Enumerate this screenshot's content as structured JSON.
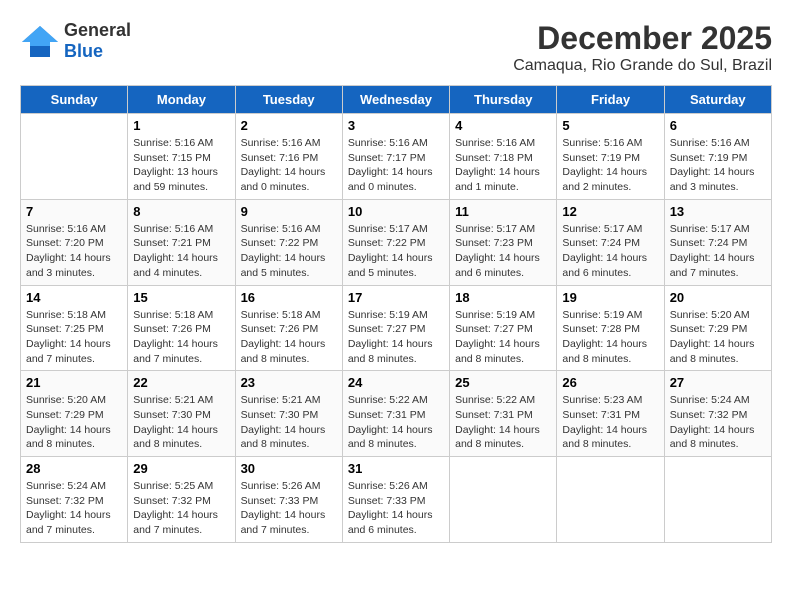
{
  "header": {
    "logo_line1": "General",
    "logo_line2": "Blue",
    "month": "December 2025",
    "location": "Camaqua, Rio Grande do Sul, Brazil"
  },
  "days_of_week": [
    "Sunday",
    "Monday",
    "Tuesday",
    "Wednesday",
    "Thursday",
    "Friday",
    "Saturday"
  ],
  "weeks": [
    [
      {
        "num": "",
        "info": ""
      },
      {
        "num": "1",
        "info": "Sunrise: 5:16 AM\nSunset: 7:15 PM\nDaylight: 13 hours\nand 59 minutes."
      },
      {
        "num": "2",
        "info": "Sunrise: 5:16 AM\nSunset: 7:16 PM\nDaylight: 14 hours\nand 0 minutes."
      },
      {
        "num": "3",
        "info": "Sunrise: 5:16 AM\nSunset: 7:17 PM\nDaylight: 14 hours\nand 0 minutes."
      },
      {
        "num": "4",
        "info": "Sunrise: 5:16 AM\nSunset: 7:18 PM\nDaylight: 14 hours\nand 1 minute."
      },
      {
        "num": "5",
        "info": "Sunrise: 5:16 AM\nSunset: 7:19 PM\nDaylight: 14 hours\nand 2 minutes."
      },
      {
        "num": "6",
        "info": "Sunrise: 5:16 AM\nSunset: 7:19 PM\nDaylight: 14 hours\nand 3 minutes."
      }
    ],
    [
      {
        "num": "7",
        "info": "Sunrise: 5:16 AM\nSunset: 7:20 PM\nDaylight: 14 hours\nand 3 minutes."
      },
      {
        "num": "8",
        "info": "Sunrise: 5:16 AM\nSunset: 7:21 PM\nDaylight: 14 hours\nand 4 minutes."
      },
      {
        "num": "9",
        "info": "Sunrise: 5:16 AM\nSunset: 7:22 PM\nDaylight: 14 hours\nand 5 minutes."
      },
      {
        "num": "10",
        "info": "Sunrise: 5:17 AM\nSunset: 7:22 PM\nDaylight: 14 hours\nand 5 minutes."
      },
      {
        "num": "11",
        "info": "Sunrise: 5:17 AM\nSunset: 7:23 PM\nDaylight: 14 hours\nand 6 minutes."
      },
      {
        "num": "12",
        "info": "Sunrise: 5:17 AM\nSunset: 7:24 PM\nDaylight: 14 hours\nand 6 minutes."
      },
      {
        "num": "13",
        "info": "Sunrise: 5:17 AM\nSunset: 7:24 PM\nDaylight: 14 hours\nand 7 minutes."
      }
    ],
    [
      {
        "num": "14",
        "info": "Sunrise: 5:18 AM\nSunset: 7:25 PM\nDaylight: 14 hours\nand 7 minutes."
      },
      {
        "num": "15",
        "info": "Sunrise: 5:18 AM\nSunset: 7:26 PM\nDaylight: 14 hours\nand 7 minutes."
      },
      {
        "num": "16",
        "info": "Sunrise: 5:18 AM\nSunset: 7:26 PM\nDaylight: 14 hours\nand 8 minutes."
      },
      {
        "num": "17",
        "info": "Sunrise: 5:19 AM\nSunset: 7:27 PM\nDaylight: 14 hours\nand 8 minutes."
      },
      {
        "num": "18",
        "info": "Sunrise: 5:19 AM\nSunset: 7:27 PM\nDaylight: 14 hours\nand 8 minutes."
      },
      {
        "num": "19",
        "info": "Sunrise: 5:19 AM\nSunset: 7:28 PM\nDaylight: 14 hours\nand 8 minutes."
      },
      {
        "num": "20",
        "info": "Sunrise: 5:20 AM\nSunset: 7:29 PM\nDaylight: 14 hours\nand 8 minutes."
      }
    ],
    [
      {
        "num": "21",
        "info": "Sunrise: 5:20 AM\nSunset: 7:29 PM\nDaylight: 14 hours\nand 8 minutes."
      },
      {
        "num": "22",
        "info": "Sunrise: 5:21 AM\nSunset: 7:30 PM\nDaylight: 14 hours\nand 8 minutes."
      },
      {
        "num": "23",
        "info": "Sunrise: 5:21 AM\nSunset: 7:30 PM\nDaylight: 14 hours\nand 8 minutes."
      },
      {
        "num": "24",
        "info": "Sunrise: 5:22 AM\nSunset: 7:31 PM\nDaylight: 14 hours\nand 8 minutes."
      },
      {
        "num": "25",
        "info": "Sunrise: 5:22 AM\nSunset: 7:31 PM\nDaylight: 14 hours\nand 8 minutes."
      },
      {
        "num": "26",
        "info": "Sunrise: 5:23 AM\nSunset: 7:31 PM\nDaylight: 14 hours\nand 8 minutes."
      },
      {
        "num": "27",
        "info": "Sunrise: 5:24 AM\nSunset: 7:32 PM\nDaylight: 14 hours\nand 8 minutes."
      }
    ],
    [
      {
        "num": "28",
        "info": "Sunrise: 5:24 AM\nSunset: 7:32 PM\nDaylight: 14 hours\nand 7 minutes."
      },
      {
        "num": "29",
        "info": "Sunrise: 5:25 AM\nSunset: 7:32 PM\nDaylight: 14 hours\nand 7 minutes."
      },
      {
        "num": "30",
        "info": "Sunrise: 5:26 AM\nSunset: 7:33 PM\nDaylight: 14 hours\nand 7 minutes."
      },
      {
        "num": "31",
        "info": "Sunrise: 5:26 AM\nSunset: 7:33 PM\nDaylight: 14 hours\nand 6 minutes."
      },
      {
        "num": "",
        "info": ""
      },
      {
        "num": "",
        "info": ""
      },
      {
        "num": "",
        "info": ""
      }
    ]
  ]
}
